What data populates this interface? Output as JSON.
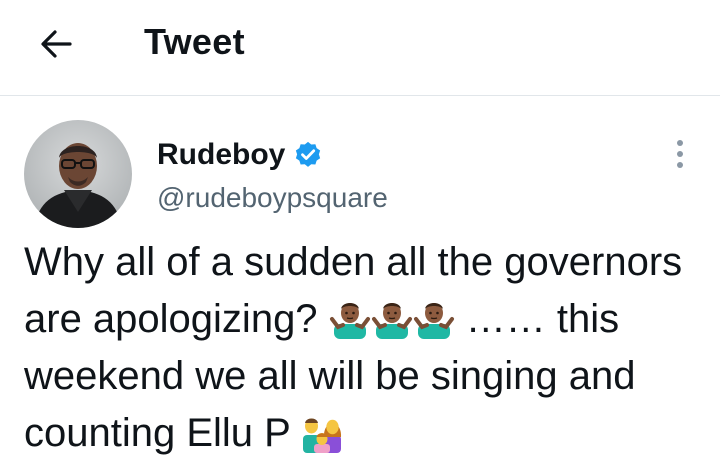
{
  "header": {
    "title": "Tweet",
    "back_icon": "arrow-left-icon"
  },
  "tweet": {
    "author": {
      "display_name": "Rudeboy",
      "handle": "@rudeboypsquare",
      "verified": true,
      "verified_color": "#1d9bf0"
    },
    "text_segments": [
      "Why all of a sudden all the governors are apologizing? ",
      "🤷🏾‍♂️",
      "🤷🏾‍♂️",
      "🤷🏾‍♂️",
      " …… this weekend we all will be singing and counting Ellu P ",
      "👨‍👩‍👧"
    ],
    "more_icon": "more-vertical-icon"
  },
  "colors": {
    "text": "#0f1419",
    "secondary_text": "#536471",
    "divider": "#e1e6ea",
    "accent": "#1d9bf0"
  }
}
